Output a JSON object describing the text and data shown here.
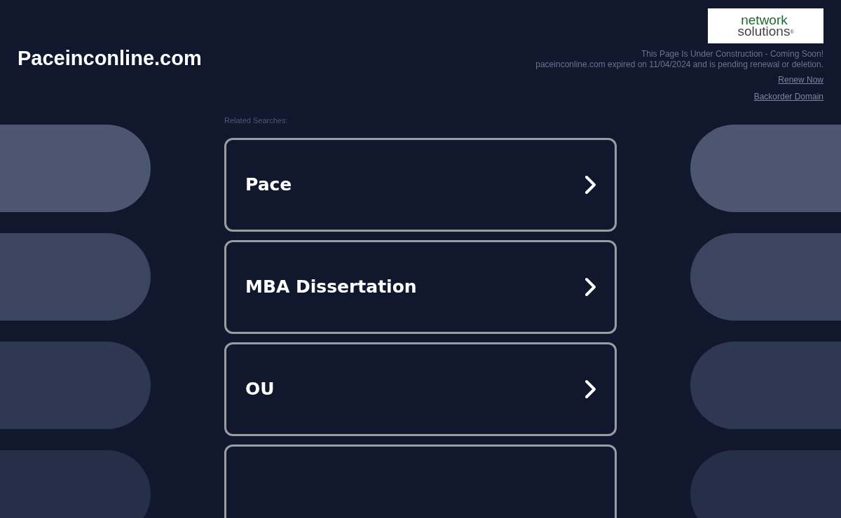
{
  "site_title": "Paceinconline.com",
  "logo": {
    "line_1": "network",
    "line_2": "solutions",
    "mark": "®"
  },
  "notice": [
    "This Page Is Under Construction - Coming Soon!",
    "paceinconline.com expired on 11/04/2024 and is pending renewal or deletion."
  ],
  "links": [
    "Renew Now",
    "Backorder Domain"
  ],
  "related_label": "Related Searches:",
  "searches": [
    {
      "label": "Pace"
    },
    {
      "label": "MBA Dissertation"
    },
    {
      "label": "OU"
    }
  ]
}
